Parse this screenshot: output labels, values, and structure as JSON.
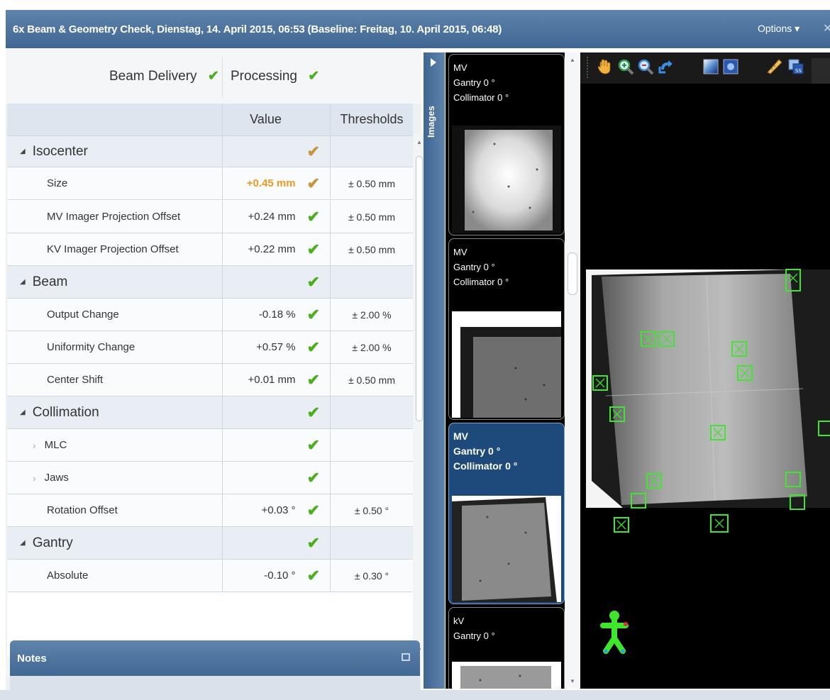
{
  "window": {
    "title": "6x Beam & Geometry Check, Dienstag, 14. April 2015, 06:53 (Baseline: Freitag, 10. April 2015, 06:48)",
    "options_label": "Options ▾",
    "close_glyph": "✕"
  },
  "status": {
    "beam_delivery": "Beam Delivery",
    "processing": "Processing",
    "check_glyph": "✔"
  },
  "grid": {
    "headers": {
      "value": "Value",
      "thresholds": "Thresholds"
    },
    "rows": [
      {
        "kind": "grp",
        "label": "Isocenter",
        "value": "",
        "check": "orange",
        "threshold": ""
      },
      {
        "kind": "item",
        "label": "Size",
        "value": "+0.45 mm",
        "warn": true,
        "check": "orange",
        "threshold": "± 0.50 mm"
      },
      {
        "kind": "item",
        "label": "MV Imager Projection Offset",
        "value": "+0.24 mm",
        "check": "green",
        "threshold": "± 0.50 mm"
      },
      {
        "kind": "item",
        "label": "KV Imager Projection Offset",
        "value": "+0.22 mm",
        "check": "green",
        "threshold": "± 0.50 mm"
      },
      {
        "kind": "grp",
        "label": "Beam",
        "value": "",
        "check": "green",
        "threshold": ""
      },
      {
        "kind": "item",
        "label": "Output Change",
        "value": "-0.18 %",
        "check": "green",
        "threshold": "± 2.00 %"
      },
      {
        "kind": "item",
        "label": "Uniformity Change",
        "value": "+0.57 %",
        "check": "green",
        "threshold": "± 2.00 %"
      },
      {
        "kind": "item",
        "label": "Center Shift",
        "value": "+0.01 mm",
        "check": "green",
        "threshold": "± 0.50 mm"
      },
      {
        "kind": "grp",
        "label": "Collimation",
        "value": "",
        "check": "green",
        "threshold": ""
      },
      {
        "kind": "sub",
        "label": "MLC",
        "value": "",
        "check": "green",
        "threshold": ""
      },
      {
        "kind": "sub",
        "label": "Jaws",
        "value": "",
        "check": "green",
        "threshold": ""
      },
      {
        "kind": "item",
        "label": "Rotation Offset",
        "value": "+0.03 °",
        "check": "green",
        "threshold": "± 0.50 °"
      },
      {
        "kind": "grp",
        "label": "Gantry",
        "value": "",
        "check": "green",
        "threshold": ""
      },
      {
        "kind": "item",
        "label": "Absolute",
        "value": "-0.10 °",
        "check": "green",
        "threshold": "± 0.30 °"
      }
    ]
  },
  "notes": {
    "label": "Notes"
  },
  "images_tab": {
    "label": "Images"
  },
  "thumbnails": [
    {
      "line1": "MV",
      "line2": "Gantry 0 °",
      "line3": "Collimator 0 °",
      "selected": false
    },
    {
      "line1": "MV",
      "line2": "Gantry 0 °",
      "line3": "Collimator 0 °",
      "selected": false
    },
    {
      "line1": "MV",
      "line2": "Gantry 0 °",
      "line3": "Collimator 0 °",
      "selected": true
    },
    {
      "line1": "kV",
      "line2": "Gantry 0 °",
      "line3": "",
      "selected": false
    }
  ],
  "toolbar_icons": [
    "pan-icon",
    "zoom-in-icon",
    "zoom-out-icon",
    "undo-icon",
    "window-level-icon",
    "invert-icon",
    "measure-icon",
    "overlay-icon"
  ],
  "colors": {
    "accent": "#4a709b",
    "check_green": "#4caf1e",
    "check_orange": "#c9953a",
    "warn_value": "#f09a1c",
    "marker_green": "#3ee62e"
  }
}
